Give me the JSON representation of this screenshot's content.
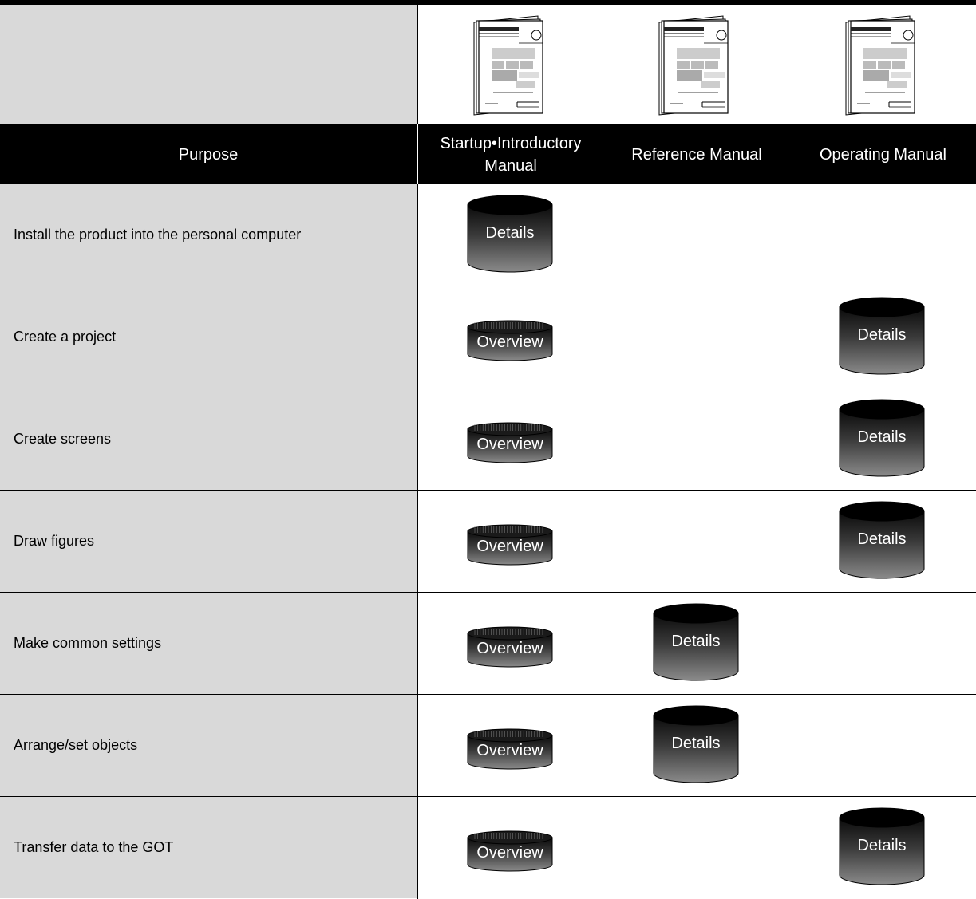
{
  "header": {
    "purpose_label": "Purpose",
    "columns": [
      {
        "label_line1": "Startup•Introductory",
        "label_line2": "Manual"
      },
      {
        "label_line1": "Reference Manual",
        "label_line2": ""
      },
      {
        "label_line1": "Operating Manual",
        "label_line2": ""
      }
    ]
  },
  "rows": [
    {
      "purpose": "Install the product into the personal computer",
      "startup": "Details",
      "reference": "",
      "operating": ""
    },
    {
      "purpose": "Create a project",
      "startup": "Overview",
      "reference": "",
      "operating": "Details"
    },
    {
      "purpose": "Create screens",
      "startup": "Overview",
      "reference": "",
      "operating": "Details"
    },
    {
      "purpose": "Draw figures",
      "startup": "Overview",
      "reference": "",
      "operating": "Details"
    },
    {
      "purpose": "Make common settings",
      "startup": "Overview",
      "reference": "Details",
      "operating": ""
    },
    {
      "purpose": "Arrange/set objects",
      "startup": "Overview",
      "reference": "Details",
      "operating": ""
    },
    {
      "purpose": "Transfer data to the GOT",
      "startup": "Overview",
      "reference": "",
      "operating": "Details"
    }
  ],
  "icons": {
    "manual_book": "book-icon",
    "overview_marker": "short-cylinder-icon",
    "details_marker": "tall-cylinder-icon"
  }
}
